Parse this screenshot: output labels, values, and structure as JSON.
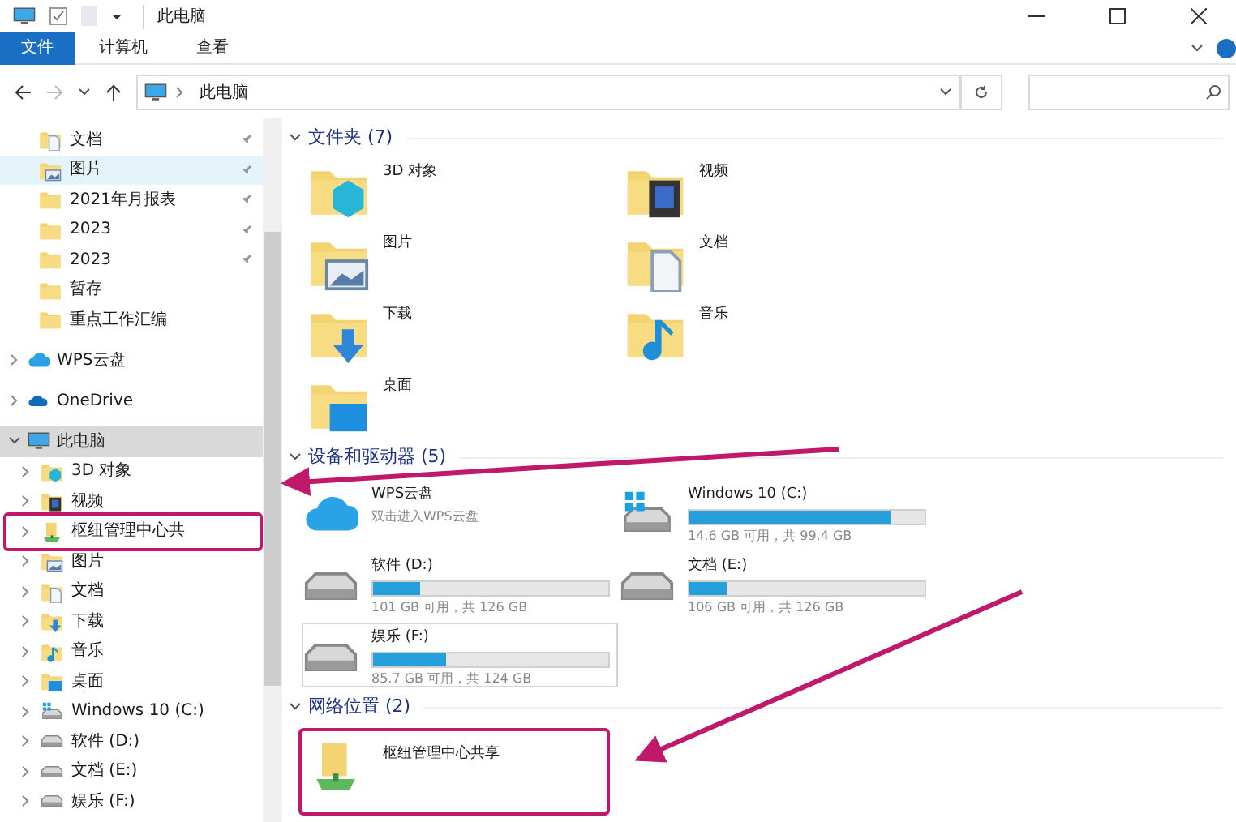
{
  "window": {
    "title": "此电脑"
  },
  "ribbon_tabs": [
    {
      "label": "文件",
      "selected": true
    },
    {
      "label": "计算机",
      "selected": false
    },
    {
      "label": "查看",
      "selected": false
    }
  ],
  "address_bar": {
    "path": "此电脑"
  },
  "sidebar": {
    "quick_access": [
      {
        "label": "文档",
        "kind": "documents",
        "pinned": true,
        "selected": false
      },
      {
        "label": "图片",
        "kind": "pictures",
        "pinned": true,
        "selected": true
      },
      {
        "label": "2021年月报表",
        "kind": "folder",
        "pinned": true,
        "selected": false
      },
      {
        "label": "2023",
        "kind": "folder",
        "pinned": true,
        "selected": false
      },
      {
        "label": "2023",
        "kind": "folder",
        "pinned": true,
        "selected": false
      },
      {
        "label": "暂存",
        "kind": "folder",
        "pinned": false,
        "selected": false
      },
      {
        "label": "重点工作汇编",
        "kind": "folder",
        "pinned": false,
        "selected": false
      }
    ],
    "locations": [
      {
        "label": "WPS云盘",
        "kind": "cloud",
        "selected": false,
        "expanded": false
      },
      {
        "label": "OneDrive",
        "kind": "onedrive",
        "selected": false,
        "expanded": false
      },
      {
        "label": "此电脑",
        "kind": "pc",
        "selected": true,
        "expanded": true,
        "children": [
          {
            "label": "3D 对象",
            "kind": "objects"
          },
          {
            "label": "视频",
            "kind": "video"
          },
          {
            "label": "枢纽管理中心共",
            "kind": "network"
          },
          {
            "label": "图片",
            "kind": "pictures"
          },
          {
            "label": "文档",
            "kind": "documents"
          },
          {
            "label": "下载",
            "kind": "downloads"
          },
          {
            "label": "音乐",
            "kind": "music"
          },
          {
            "label": "桌面",
            "kind": "desktop"
          },
          {
            "label": "Windows 10 (C:)",
            "kind": "system"
          },
          {
            "label": "软件 (D:)",
            "kind": "drive"
          },
          {
            "label": "文档 (E:)",
            "kind": "drive"
          },
          {
            "label": "娱乐 (F:)",
            "kind": "drive"
          }
        ]
      }
    ]
  },
  "folders": {
    "header": "文件夹 (7)",
    "items": [
      {
        "label": "3D 对象",
        "kind": "objects"
      },
      {
        "label": "视频",
        "kind": "video"
      },
      {
        "label": "图片",
        "kind": "pictures"
      },
      {
        "label": "文档",
        "kind": "documents"
      },
      {
        "label": "下载",
        "kind": "downloads"
      },
      {
        "label": "音乐",
        "kind": "music"
      },
      {
        "label": "桌面",
        "kind": "desktop"
      }
    ]
  },
  "devices": {
    "header": "设备和驱动器 (5)",
    "items": [
      {
        "label": "WPS云盘",
        "kind": "cloud",
        "subtitle": "双击进入WPS云盘",
        "selected": false
      },
      {
        "label": "Windows 10 (C:)",
        "kind": "system",
        "level": 0.853,
        "space": "14.6 GB 可用，共 99.4 GB",
        "selected": false
      },
      {
        "label": "软件 (D:)",
        "kind": "drive",
        "level": 0.2,
        "space": "101 GB 可用，共 126 GB",
        "selected": false
      },
      {
        "label": "文档 (E:)",
        "kind": "drive",
        "level": 0.16,
        "space": "106 GB 可用，共 126 GB",
        "selected": false
      },
      {
        "label": "娱乐 (F:)",
        "kind": "drive",
        "level": 0.31,
        "space": "85.7 GB 可用，共 124 GB",
        "selected": true
      }
    ]
  },
  "network": {
    "header": "网络位置 (2)",
    "items": [
      {
        "label": "枢纽管理中心共享",
        "kind": "network"
      }
    ]
  }
}
